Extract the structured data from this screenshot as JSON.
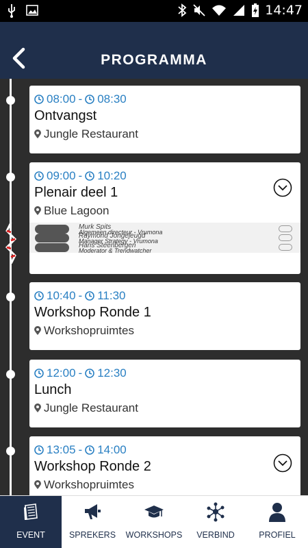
{
  "status": {
    "time": "14:47"
  },
  "header": {
    "title": "PROGRAMMA"
  },
  "events": [
    {
      "start": "08:00",
      "end": "08:30",
      "title": "Ontvangst",
      "location": "Jungle Restaurant"
    },
    {
      "start": "09:00",
      "end": "10:20",
      "title": "Plenair deel 1",
      "location": "Blue Lagoon",
      "speakers": [
        {
          "name": "Murk Spits",
          "role": "Algemeen directeur - Vrumona"
        },
        {
          "name": "Raymond Jongejeugd",
          "role": "Manager Strategy - Vrumona"
        },
        {
          "name": "Hans Steenbergen",
          "role": "Moderator & Trendwatcher"
        }
      ]
    },
    {
      "start": "10:40",
      "end": "11:30",
      "title": "Workshop Ronde 1",
      "location": "Workshopruimtes"
    },
    {
      "start": "12:00",
      "end": "12:30",
      "title": "Lunch",
      "location": "Jungle Restaurant"
    },
    {
      "start": "13:05",
      "end": "14:00",
      "title": "Workshop Ronde 2",
      "location": "Workshopruimtes"
    }
  ],
  "nav": {
    "event": "EVENT",
    "sprekers": "SPREKERS",
    "workshops": "WORKSHOPS",
    "verbind": "VERBIND",
    "profiel": "PROFIEL"
  },
  "colors": {
    "primary": "#1f2f4b",
    "accent": "#2a80c3",
    "background": "#2d2d2d"
  }
}
